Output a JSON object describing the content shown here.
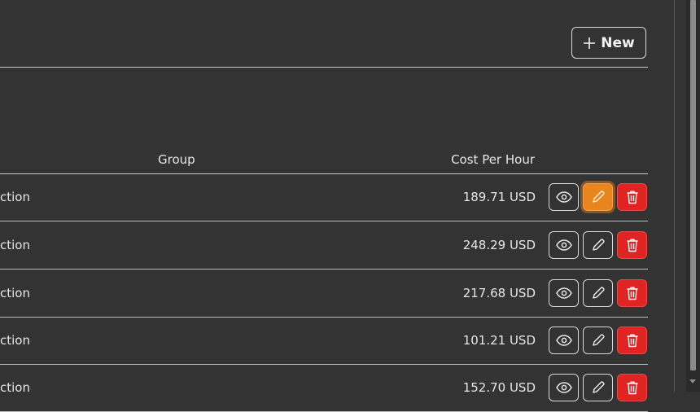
{
  "toolbar": {
    "new_label": "New"
  },
  "table": {
    "columns": {
      "group": "Group",
      "cost": "Cost Per Hour"
    },
    "rows": [
      {
        "name": "ction",
        "cost": "189.71 USD"
      },
      {
        "name": "ction",
        "cost": "248.29 USD"
      },
      {
        "name": "ction",
        "cost": "217.68 USD"
      },
      {
        "name": "ction",
        "cost": "101.21 USD"
      },
      {
        "name": "ction",
        "cost": "152.70 USD"
      }
    ]
  },
  "icons": {
    "view": "eye-icon",
    "edit": "pencil-icon",
    "delete": "trash-icon",
    "new": "plus-icon"
  },
  "colors": {
    "background": "#333333",
    "delete": "#e02424",
    "edit_active": "#e8851c"
  }
}
